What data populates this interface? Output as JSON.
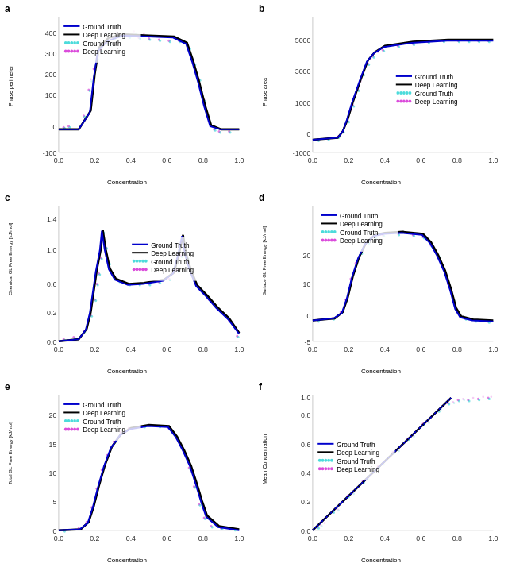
{
  "panels": [
    {
      "id": "a",
      "label": "a",
      "y_axis": "Phase perimeter",
      "x_axis": "Concentration",
      "y_min": -100,
      "y_max": 450,
      "x_min": 0.0,
      "x_max": 1.0,
      "legend_items": [
        {
          "label": "Ground Truth",
          "color": "#0000cc",
          "style": "solid"
        },
        {
          "label": "Deep Learning",
          "color": "#000000",
          "style": "solid"
        },
        {
          "label": "Ground Truth",
          "color": "#00cccc",
          "style": "dots"
        },
        {
          "label": "Deep Learning",
          "color": "#cc00cc",
          "style": "dots"
        }
      ]
    },
    {
      "id": "b",
      "label": "b",
      "y_axis": "Phase area",
      "x_axis": "Concentration",
      "y_min": -1000,
      "y_max": 5000,
      "x_min": 0.0,
      "x_max": 1.0,
      "legend_items": [
        {
          "label": "Ground Truth",
          "color": "#0000cc",
          "style": "solid"
        },
        {
          "label": "Deep Learning",
          "color": "#000000",
          "style": "solid"
        },
        {
          "label": "Ground Truth",
          "color": "#00cccc",
          "style": "dots"
        },
        {
          "label": "Deep Learning",
          "color": "#cc00cc",
          "style": "dots"
        }
      ]
    },
    {
      "id": "c",
      "label": "c",
      "y_axis": "Chemical GL Free Energy [kJ/mol]",
      "x_axis": "Concentration",
      "y_min": 0.0,
      "y_max": 1.4,
      "x_min": 0.0,
      "x_max": 1.0,
      "legend_items": [
        {
          "label": "Ground Truth",
          "color": "#0000cc",
          "style": "solid"
        },
        {
          "label": "Deep Learning",
          "color": "#000000",
          "style": "solid"
        },
        {
          "label": "Ground Truth",
          "color": "#00cccc",
          "style": "dots"
        },
        {
          "label": "Deep Learning",
          "color": "#cc00cc",
          "style": "dots"
        }
      ]
    },
    {
      "id": "d",
      "label": "d",
      "y_axis": "Surface GL Free Energy [kJ/mol]",
      "x_axis": "Concentration",
      "y_min": -5,
      "y_max": 25,
      "x_min": 0.0,
      "x_max": 1.0,
      "legend_items": [
        {
          "label": "Ground Truth",
          "color": "#0000cc",
          "style": "solid"
        },
        {
          "label": "Deep Learning",
          "color": "#000000",
          "style": "solid"
        },
        {
          "label": "Ground Truth",
          "color": "#00cccc",
          "style": "dots"
        },
        {
          "label": "Deep Learning",
          "color": "#cc00cc",
          "style": "dots"
        }
      ]
    },
    {
      "id": "e",
      "label": "e",
      "y_axis": "Total GL Free Energy [kJ/mol]",
      "x_axis": "Concentration",
      "y_min": 0,
      "y_max": 25,
      "x_min": 0.0,
      "x_max": 1.0,
      "legend_items": [
        {
          "label": "Ground Truth",
          "color": "#0000cc",
          "style": "solid"
        },
        {
          "label": "Deep Learning",
          "color": "#000000",
          "style": "solid"
        },
        {
          "label": "Ground Truth",
          "color": "#00cccc",
          "style": "dots"
        },
        {
          "label": "Deep Learning",
          "color": "#cc00cc",
          "style": "dots"
        }
      ]
    },
    {
      "id": "f",
      "label": "f",
      "y_axis": "Mean Concentration",
      "x_axis": "Concentration",
      "y_min": 0.0,
      "y_max": 1.0,
      "x_min": 0.0,
      "x_max": 1.0,
      "legend_items": [
        {
          "label": "Ground Truth",
          "color": "#0000cc",
          "style": "solid"
        },
        {
          "label": "Deep Learning",
          "color": "#000000",
          "style": "solid"
        },
        {
          "label": "Ground Truth",
          "color": "#00cccc",
          "style": "dots"
        },
        {
          "label": "Deep Learning",
          "color": "#cc00cc",
          "style": "dots"
        }
      ]
    }
  ],
  "legend_top": {
    "label_gt": "Ground Truth",
    "label_dl": "Deep Learning"
  },
  "colors": {
    "blue_line": "#0000cc",
    "black_line": "#000000",
    "cyan_dots": "#00cccc",
    "magenta_dots": "#cc00cc",
    "axis": "#555555",
    "grid": "#cccccc"
  }
}
